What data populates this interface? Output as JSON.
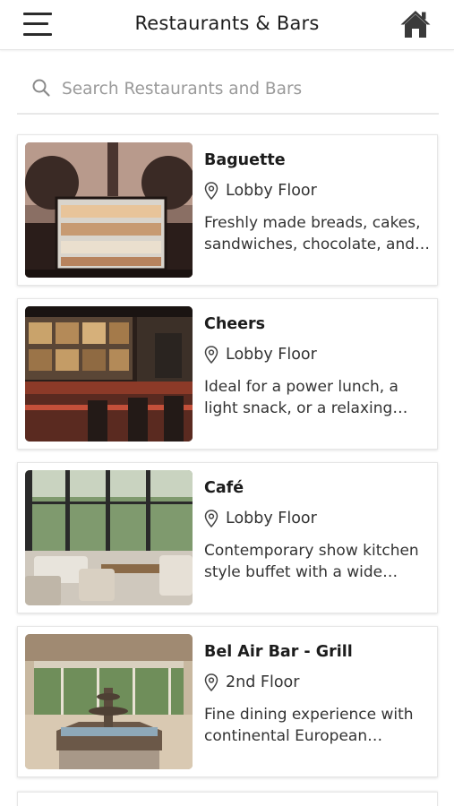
{
  "header": {
    "title": "Restaurants & Bars",
    "menu_icon": "hamburger-menu-icon",
    "home_icon": "home-icon"
  },
  "search": {
    "placeholder": "Search Restaurants and Bars",
    "value": "",
    "icon": "search-icon"
  },
  "venues": [
    {
      "name": "Baguette",
      "floor": "Lobby Floor",
      "description": "Freshly made breads, cakes, sandwiches, chocolate, and c..."
    },
    {
      "name": "Cheers",
      "floor": "Lobby Floor",
      "description": "Ideal for a power lunch, a light snack, or a relaxing evening..."
    },
    {
      "name": "Café",
      "floor": "Lobby Floor",
      "description": "Contemporary show kitchen style buffet with a wide varie..."
    },
    {
      "name": "Bel Air Bar - Grill",
      "floor": "2nd Floor",
      "description": "Fine dining experience with continental European cuisine..."
    }
  ],
  "colors": {
    "text": "#1c1c1c",
    "muted": "#9a9a9a",
    "divider": "#e6e6e6",
    "background": "#ffffff"
  }
}
